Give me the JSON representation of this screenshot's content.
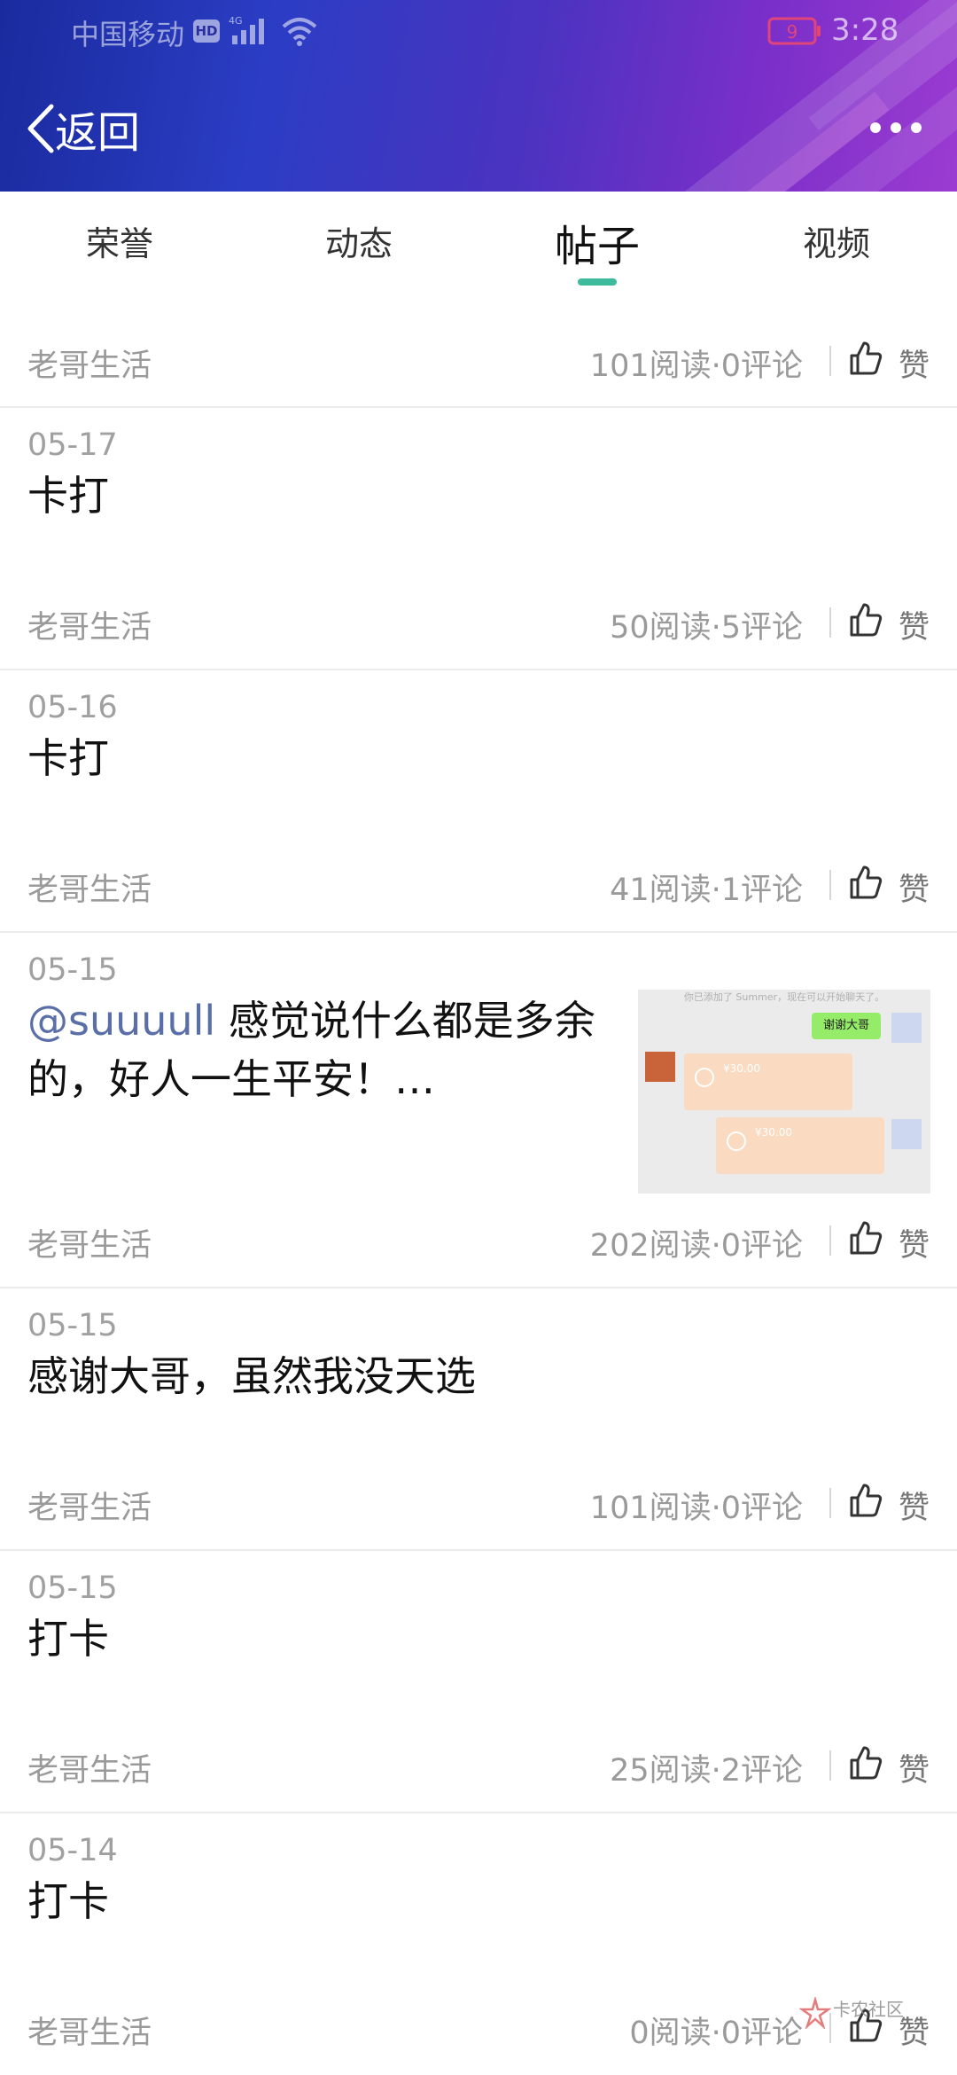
{
  "status_bar": {
    "carrier": "中国移动",
    "hd": "HD",
    "network": "4G",
    "battery": "9",
    "time": "3:28"
  },
  "header": {
    "back_label": "返回",
    "back_icon": "chevron-left-icon",
    "more_icon": "more-dots-icon"
  },
  "tabs": [
    {
      "label": "荣誉",
      "active": false
    },
    {
      "label": "动态",
      "active": false
    },
    {
      "label": "帖子",
      "active": true
    },
    {
      "label": "视频",
      "active": false
    }
  ],
  "accent_color": "#3dbb9c",
  "posts": [
    {
      "date": "",
      "title": "",
      "author": "老哥生活",
      "stats": "101阅读·0评论",
      "like_label": "赞"
    },
    {
      "date": "05-17",
      "title": "卡打",
      "author": "老哥生活",
      "stats": "50阅读·5评论",
      "like_label": "赞"
    },
    {
      "date": "05-16",
      "title": "卡打",
      "author": "老哥生活",
      "stats": "41阅读·1评论",
      "like_label": "赞"
    },
    {
      "date": "05-15",
      "mention": "@suuuull",
      "title": " 感觉说什么都是多余",
      "title_line2": "的，好人一生平安！…",
      "author": "老哥生活",
      "stats": "202阅读·0评论",
      "like_label": "赞",
      "thumbnail": {
        "system_text": "你已添加了 Summer，现在可以开始聊天了。",
        "green_message": "谢谢大哥",
        "pay_amount_1": "¥30.00",
        "pay_amount_2": "¥30.00"
      }
    },
    {
      "date": "05-15",
      "title": "感谢大哥，虽然我没天选",
      "author": "老哥生活",
      "stats": "101阅读·0评论",
      "like_label": "赞"
    },
    {
      "date": "05-15",
      "title": "打卡",
      "author": "老哥生活",
      "stats": "25阅读·2评论",
      "like_label": "赞"
    },
    {
      "date": "05-14",
      "title": "打卡",
      "author": "老哥生活",
      "stats": "0阅读·0评论",
      "like_label": "赞"
    }
  ],
  "watermark": {
    "text": "卡农社区"
  }
}
